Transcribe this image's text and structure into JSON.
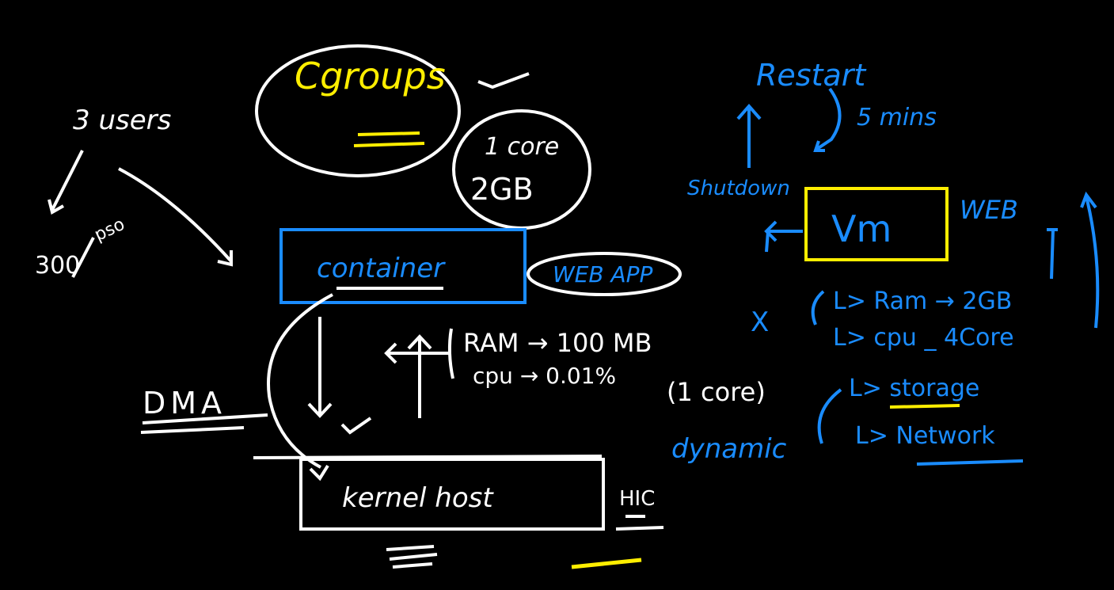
{
  "colors": {
    "background": "#000000",
    "white": "#ffffff",
    "blue": "#1a8cff",
    "yellow": "#ffee00"
  },
  "labels": {
    "cgroups": "Cgroups",
    "users": "3 users",
    "pso": "pso",
    "n300": "300",
    "core1": "1 core",
    "gb2": "2GB",
    "container": "container",
    "webapp": "WEB APP",
    "dma": "DMA",
    "ram_line": "RAM → 100 MB",
    "cpu_line": "cpu → 0.01%",
    "one_core": "(1 core)",
    "kernel": "kernel host",
    "hic": "HIC",
    "restart": "Restart",
    "five_min": "5 mins",
    "shutdown": "Shutdown",
    "vm": "Vm",
    "web": "WEB",
    "ram_vm": "L> Ram → 2GB",
    "cpu_vm": "L> cpu _ 4Core",
    "storage_vm": "L> storage",
    "network_vm": "L> Network",
    "dynamic": "dynamic",
    "x_mark": "X"
  }
}
